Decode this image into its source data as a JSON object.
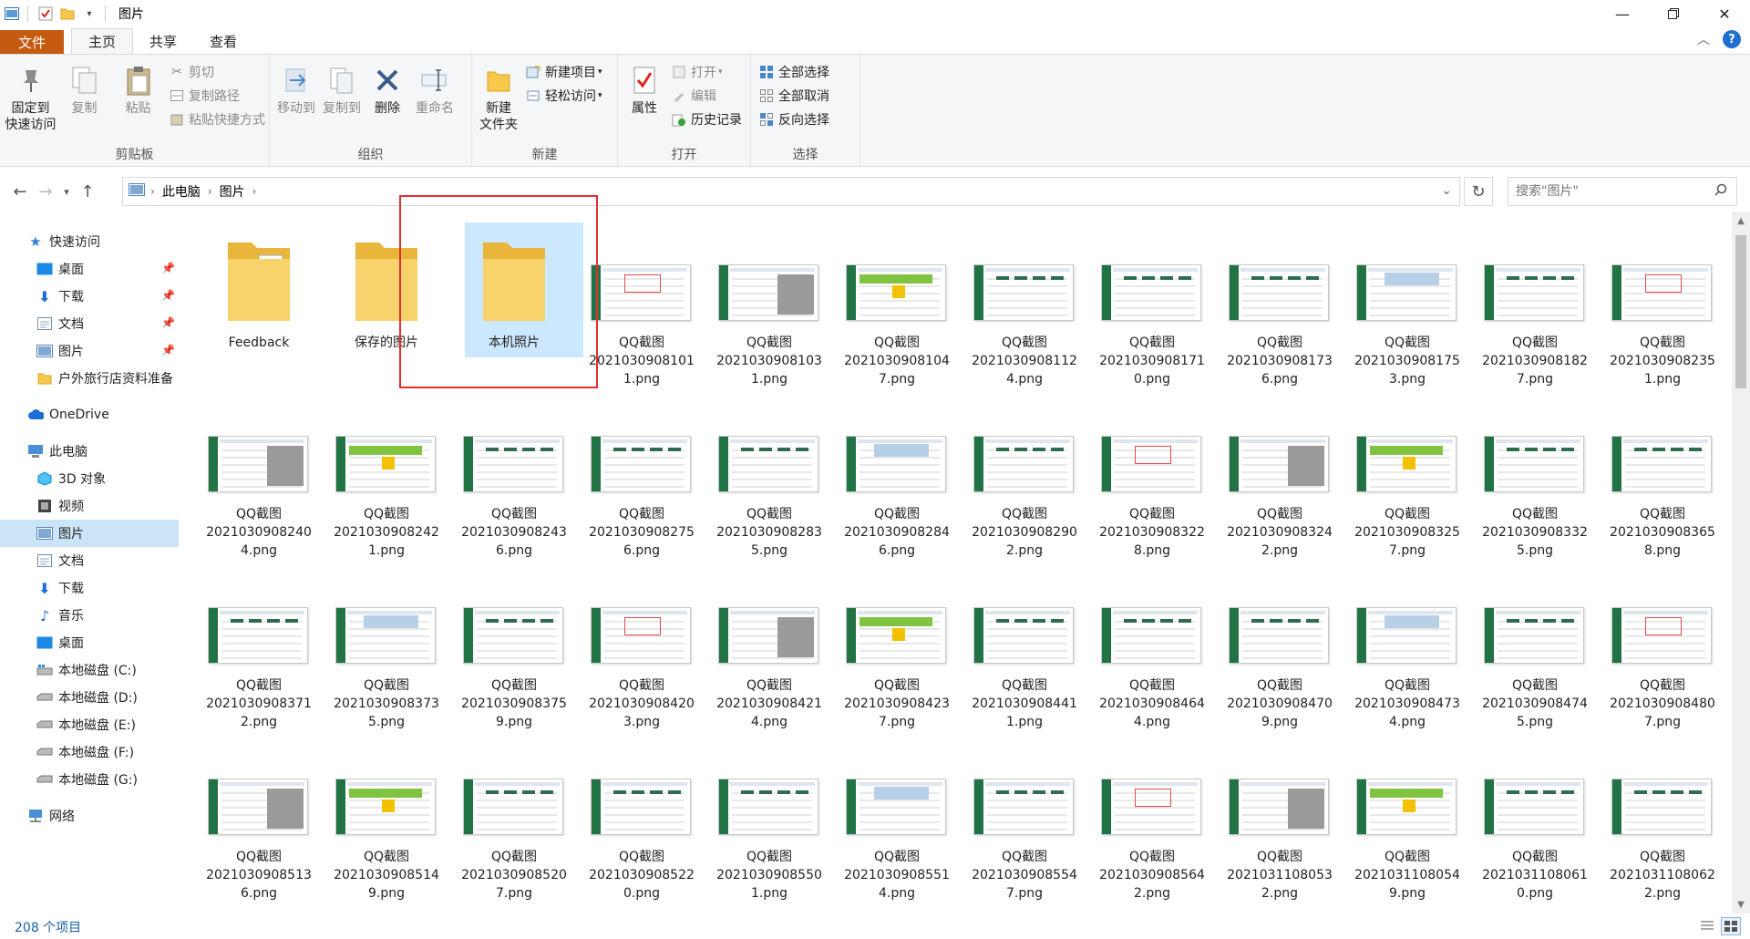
{
  "window": {
    "title": "图片"
  },
  "tabs": [
    "文件",
    "主页",
    "共享",
    "查看"
  ],
  "ribbon": {
    "clipboard": {
      "label": "剪贴板",
      "pin": "固定到\n快速访问",
      "copy": "复制",
      "paste": "粘贴",
      "cut": "剪切",
      "copy_path": "复制路径",
      "paste_shortcut": "粘贴快捷方式"
    },
    "organize": {
      "label": "组织",
      "move_to": "移动到",
      "copy_to": "复制到",
      "delete": "删除",
      "rename": "重命名"
    },
    "new": {
      "label": "新建",
      "new_folder": "新建\n文件夹",
      "new_item": "新建项目",
      "easy_access": "轻松访问"
    },
    "open": {
      "label": "打开",
      "properties": "属性",
      "open": "打开",
      "edit": "编辑",
      "history": "历史记录"
    },
    "select": {
      "label": "选择",
      "select_all": "全部选择",
      "select_none": "全部取消",
      "invert": "反向选择"
    }
  },
  "address": {
    "crumbs": [
      "此电脑",
      "图片"
    ]
  },
  "search": {
    "placeholder": "搜索\"图片\""
  },
  "navpane": {
    "quick_access": "快速访问",
    "quick_items": [
      "桌面",
      "下载",
      "文档",
      "图片",
      "户外旅行店资料准备"
    ],
    "onedrive": "OneDrive",
    "this_pc": "此电脑",
    "pc_items": [
      "3D 对象",
      "视频",
      "图片",
      "文档",
      "下载",
      "音乐",
      "桌面",
      "本地磁盘 (C:)",
      "本地磁盘 (D:)",
      "本地磁盘 (E:)",
      "本地磁盘 (F:)",
      "本地磁盘 (G:)"
    ],
    "network": "网络"
  },
  "items": [
    {
      "name": "Feedback",
      "type": "folder"
    },
    {
      "name": "保存的图片",
      "type": "folder"
    },
    {
      "name": "本机照片",
      "type": "folder"
    },
    {
      "name": "QQ截图\n2021030908101\n1.png",
      "type": "image"
    },
    {
      "name": "QQ截图\n2021030908103\n1.png",
      "type": "image"
    },
    {
      "name": "QQ截图\n2021030908104\n7.png",
      "type": "image"
    },
    {
      "name": "QQ截图\n2021030908112\n4.png",
      "type": "image"
    },
    {
      "name": "QQ截图\n2021030908171\n0.png",
      "type": "image"
    },
    {
      "name": "QQ截图\n2021030908173\n6.png",
      "type": "image"
    },
    {
      "name": "QQ截图\n2021030908175\n3.png",
      "type": "image"
    },
    {
      "name": "QQ截图\n2021030908182\n7.png",
      "type": "image"
    },
    {
      "name": "QQ截图\n2021030908235\n1.png",
      "type": "image"
    },
    {
      "name": "QQ截图\n2021030908240\n4.png",
      "type": "image"
    },
    {
      "name": "QQ截图\n2021030908242\n1.png",
      "type": "image"
    },
    {
      "name": "QQ截图\n2021030908243\n6.png",
      "type": "image"
    },
    {
      "name": "QQ截图\n2021030908275\n6.png",
      "type": "image"
    },
    {
      "name": "QQ截图\n2021030908283\n5.png",
      "type": "image"
    },
    {
      "name": "QQ截图\n2021030908284\n6.png",
      "type": "image"
    },
    {
      "name": "QQ截图\n2021030908290\n2.png",
      "type": "image"
    },
    {
      "name": "QQ截图\n2021030908322\n8.png",
      "type": "image"
    },
    {
      "name": "QQ截图\n2021030908324\n2.png",
      "type": "image"
    },
    {
      "name": "QQ截图\n2021030908325\n7.png",
      "type": "image"
    },
    {
      "name": "QQ截图\n2021030908332\n5.png",
      "type": "image"
    },
    {
      "name": "QQ截图\n2021030908365\n8.png",
      "type": "image"
    },
    {
      "name": "QQ截图\n2021030908371\n2.png",
      "type": "image"
    },
    {
      "name": "QQ截图\n2021030908373\n5.png",
      "type": "image"
    },
    {
      "name": "QQ截图\n2021030908375\n9.png",
      "type": "image"
    },
    {
      "name": "QQ截图\n2021030908420\n3.png",
      "type": "image"
    },
    {
      "name": "QQ截图\n2021030908421\n4.png",
      "type": "image"
    },
    {
      "name": "QQ截图\n2021030908423\n7.png",
      "type": "image"
    },
    {
      "name": "QQ截图\n2021030908441\n1.png",
      "type": "image"
    },
    {
      "name": "QQ截图\n2021030908464\n4.png",
      "type": "image"
    },
    {
      "name": "QQ截图\n2021030908470\n9.png",
      "type": "image"
    },
    {
      "name": "QQ截图\n2021030908473\n4.png",
      "type": "image"
    },
    {
      "name": "QQ截图\n2021030908474\n5.png",
      "type": "image"
    },
    {
      "name": "QQ截图\n2021030908480\n7.png",
      "type": "image"
    },
    {
      "name": "QQ截图\n2021030908513\n6.png",
      "type": "image"
    },
    {
      "name": "QQ截图\n2021030908514\n9.png",
      "type": "image"
    },
    {
      "name": "QQ截图\n2021030908520\n7.png",
      "type": "image"
    },
    {
      "name": "QQ截图\n2021030908522\n0.png",
      "type": "image"
    },
    {
      "name": "QQ截图\n2021030908550\n1.png",
      "type": "image"
    },
    {
      "name": "QQ截图\n2021030908551\n4.png",
      "type": "image"
    },
    {
      "name": "QQ截图\n2021030908554\n7.png",
      "type": "image"
    },
    {
      "name": "QQ截图\n2021030908564\n2.png",
      "type": "image"
    },
    {
      "name": "QQ截图\n2021031108053\n2.png",
      "type": "image"
    },
    {
      "name": "QQ截图\n2021031108054\n9.png",
      "type": "image"
    },
    {
      "name": "QQ截图\n2021031108061\n0.png",
      "type": "image"
    },
    {
      "name": "QQ截图\n2021031108062\n2.png",
      "type": "image"
    }
  ],
  "selected_item": "本机照片",
  "status": {
    "count": "208 个项目"
  },
  "colors": {
    "file_tab": "#c55a11",
    "selection": "#cce8ff",
    "highlight_box": "#e03030",
    "excel_green": "#217346",
    "folder": "#f6c84c"
  }
}
